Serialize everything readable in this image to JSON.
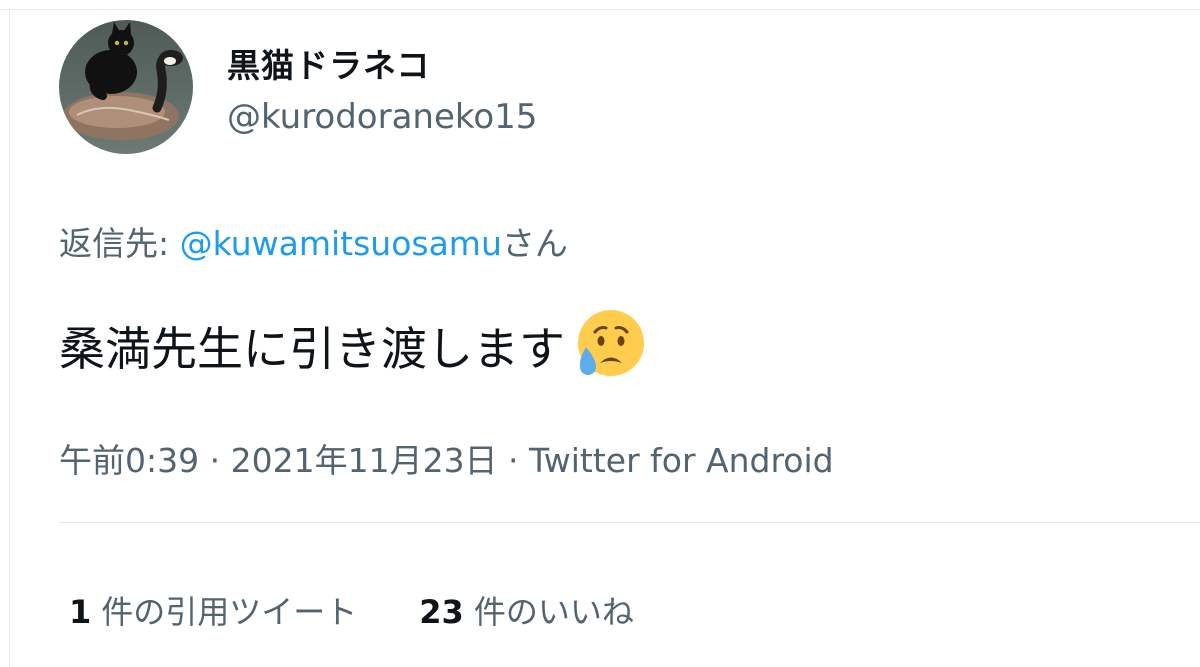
{
  "user": {
    "display_name": "黒猫ドラネコ",
    "handle": "@kurodoraneko15"
  },
  "reply": {
    "prefix": "返信先: ",
    "mention": "@kuwamitsuosamu",
    "suffix": "さん"
  },
  "tweet": {
    "text": "桑満先生に引き渡します",
    "emoji": "sad-but-relieved-face-icon"
  },
  "meta": {
    "time": "午前0:39",
    "separator": " · ",
    "date": "2021年11月23日",
    "source": "Twitter for Android"
  },
  "stats": {
    "quotes_count": "1",
    "quotes_label": "件の引用ツイート",
    "likes_count": "23",
    "likes_label": "件のいいね"
  },
  "colors": {
    "text_primary": "#0f1419",
    "text_secondary": "#536471",
    "mention": "#1d9bf0",
    "divider": "#e1e8ed"
  }
}
